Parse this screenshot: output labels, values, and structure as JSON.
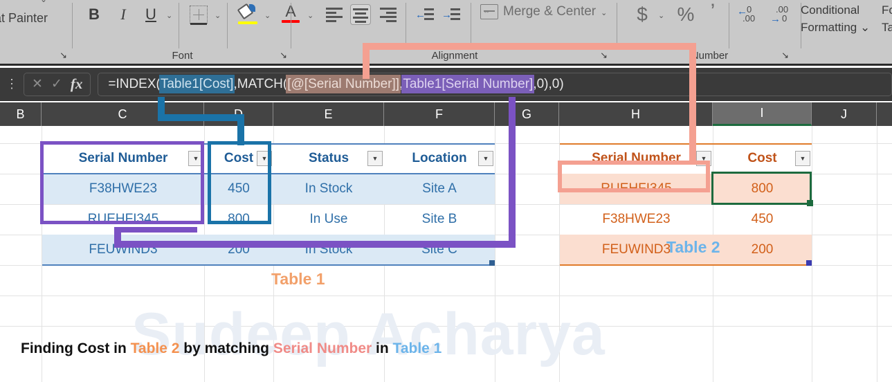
{
  "ribbon": {
    "groups": [
      {
        "name": "clipboard",
        "label": "",
        "launcher": "↘"
      },
      {
        "name": "font",
        "label": "Font",
        "launcher": "↘"
      },
      {
        "name": "alignment",
        "label": "Alignment",
        "launcher": "↘"
      },
      {
        "name": "number",
        "label": "Number",
        "launcher": "↘"
      },
      {
        "name": "styles",
        "label": "",
        "launcher": ""
      }
    ],
    "clipboard": {
      "format_painter": "at Painter"
    },
    "font": {
      "bold": "B",
      "italic": "I",
      "underline": "U",
      "borders_icon": "borders-icon",
      "fill_color_icon": "fill-color-icon",
      "fill_color": "#ffff00",
      "font_color_icon": "font-color-icon",
      "font_color": "#ff0000",
      "dropdown": "⌄"
    },
    "alignment": {
      "align_left": "align-left-icon",
      "align_center": "align-center-icon",
      "align_right": "align-right-icon",
      "decrease_indent": "decrease-indent-icon",
      "increase_indent": "increase-indent-icon",
      "merge_center_label": "Merge & Center",
      "merge_center_icon": "merge-cells-icon"
    },
    "number": {
      "currency": "$",
      "percent": "%",
      "comma": "’",
      "decrease_decimal": "decrease-decimal-icon",
      "increase_decimal": "increase-decimal-icon",
      "dec_glyph": ".00",
      "inc_glyph": ".00",
      "dec_arrow": "←",
      "inc_arrow": "→",
      "dec_zero": "0",
      "inc_zero": "0"
    },
    "styles": {
      "conditional_formatting_line1": "Conditional",
      "conditional_formatting_line2": "Formatting ⌄",
      "format_as_table_line1": "For",
      "format_as_table_line2": "Ta"
    }
  },
  "formula_bar": {
    "cancel_icon": "cancel-icon",
    "enter_icon": "confirm-icon",
    "fx_icon": "fx",
    "menu_icon": "⋮",
    "formula_full": "=INDEX(Table1[Cost],MATCH([@[Serial Number]],Table1[Serial Number],0),0)",
    "tokens": {
      "t0": "=INDEX(",
      "t1": "Table1[Cost]",
      "t2": ",MATCH(",
      "t3": "[@[Serial Number]]",
      "t4": ",",
      "t5": "Table1[Serial Number]",
      "t6": ",0),0)"
    }
  },
  "columns": [
    {
      "letter": "B",
      "active": false
    },
    {
      "letter": "C",
      "active": false
    },
    {
      "letter": "D",
      "active": false
    },
    {
      "letter": "E",
      "active": false
    },
    {
      "letter": "F",
      "active": false
    },
    {
      "letter": "G",
      "active": false
    },
    {
      "letter": "H",
      "active": false
    },
    {
      "letter": "I",
      "active": true
    },
    {
      "letter": "J",
      "active": false
    }
  ],
  "watermark": "Sudeep Acharya",
  "table1": {
    "label": "Table 1",
    "label_color": "#f2a06a",
    "headers": [
      "Serial Number",
      "Cost",
      "Status",
      "Location"
    ],
    "rows": [
      [
        "F38HWE23",
        "450",
        "In Stock",
        "Site A"
      ],
      [
        "RUEHFI345",
        "800",
        "In Use",
        "Site B"
      ],
      [
        "FEUWIND3",
        "200",
        "In Stock",
        "Site C"
      ]
    ],
    "text_color": "#2f6fa8",
    "band_color": "#dbe9f5"
  },
  "table2": {
    "label": "Table 2",
    "label_color": "#6cb4ea",
    "headers": [
      "Serial Number",
      "Cost"
    ],
    "rows": [
      [
        "RUEHFI345",
        "800"
      ],
      [
        "F38HWE23",
        "450"
      ],
      [
        "FEUWIND3",
        "200"
      ]
    ],
    "text_color": "#d2601a",
    "band_color": "#fbded0",
    "active_cell_value": "800",
    "highlighted_lookup_value": "RUEHFI345"
  },
  "annotations": {
    "blue_color": "#1a73a8",
    "purple_color": "#7b52c4",
    "salmon_color": "#f4a091",
    "brown_color": "#9d7b70",
    "green_color": "#1d6b3e"
  },
  "caption": {
    "part1": "Finding Cost in ",
    "table2": "Table 2",
    "table2_color": "#f4914f",
    "part2": " by matching ",
    "serial": "Serial Number",
    "serial_color": "#f08b87",
    "part3": " in ",
    "table1": "Table 1",
    "table1_color": "#6cb4ea"
  }
}
